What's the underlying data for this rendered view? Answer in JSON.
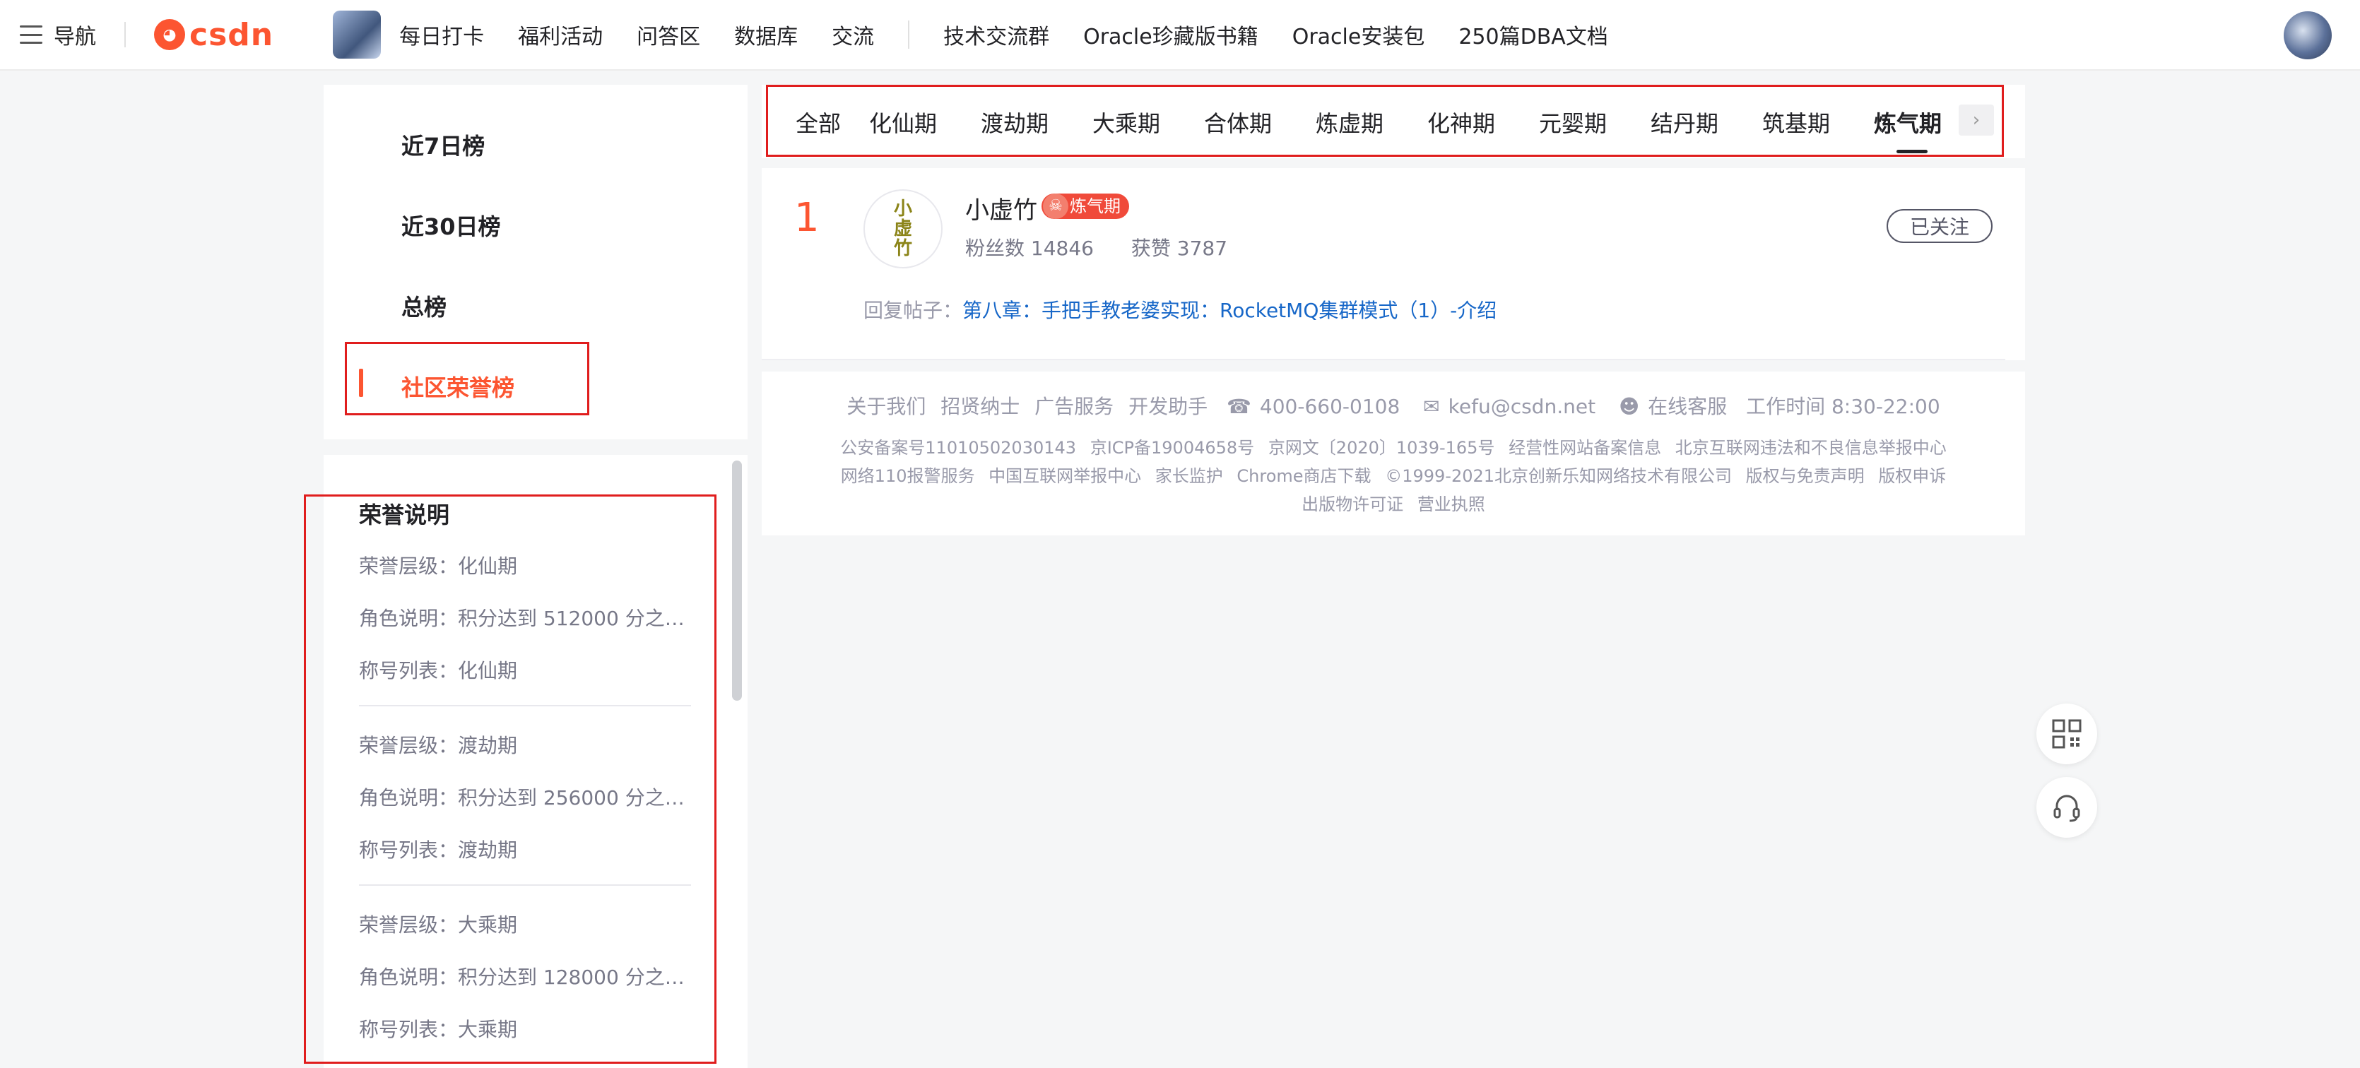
{
  "topbar": {
    "nav_label": "导航",
    "logo_text": "csdn",
    "links": [
      "每日打卡",
      "福利活动",
      "问答区",
      "数据库",
      "交流"
    ],
    "links2": [
      "技术交流群",
      "Oracle珍藏版书籍",
      "Oracle安装包",
      "250篇DBA文档"
    ]
  },
  "sidebar": {
    "items": [
      "近7日榜",
      "近30日榜",
      "总榜",
      "社区荣誉榜"
    ],
    "active_index": 3
  },
  "honor": {
    "title": "荣誉说明",
    "groups": [
      {
        "level": "荣誉层级：化仙期",
        "role": "角色说明：积分达到 512000 分之…",
        "titles": "称号列表：化仙期"
      },
      {
        "level": "荣誉层级：渡劫期",
        "role": "角色说明：积分达到 256000 分之…",
        "titles": "称号列表：渡劫期"
      },
      {
        "level": "荣誉层级：大乘期",
        "role": "角色说明：积分达到 128000 分之…",
        "titles": "称号列表：大乘期"
      }
    ]
  },
  "tabs": {
    "items": [
      "全部",
      "化仙期",
      "渡劫期",
      "大乘期",
      "合体期",
      "炼虚期",
      "化神期",
      "元婴期",
      "结丹期",
      "筑基期",
      "炼气期"
    ],
    "active_index": 10
  },
  "rank": {
    "number": "1",
    "avatar_text": "小虚竹",
    "name": "小虚竹",
    "badge": "炼气期",
    "fans": "粉丝数 14846",
    "likes": "获赞 3787",
    "follow_label": "已关注",
    "reply_label": "回复帖子：",
    "reply_link": "第八章：手把手教老婆实现：RocketMQ集群模式（1）-介绍"
  },
  "footer": {
    "line1": [
      "关于我们",
      "招贤纳士",
      "广告服务",
      "开发助手"
    ],
    "phone": "400-660-0108",
    "email": "kefu@csdn.net",
    "service": "在线客服",
    "hours": "工作时间 8:30-22:00",
    "line2": [
      "公安备案号11010502030143",
      "京ICP备19004658号",
      "京网文〔2020〕1039-165号",
      "经营性网站备案信息",
      "北京互联网违法和不良信息举报中心"
    ],
    "line3": [
      "网络110报警服务",
      "中国互联网举报中心",
      "家长监护",
      "Chrome商店下载",
      "©1999-2021北京创新乐知网络技术有限公司",
      "版权与免责声明",
      "版权申诉"
    ],
    "line4": [
      "出版物许可证",
      "营业执照"
    ]
  },
  "colors": {
    "accent": "#fc5531",
    "link": "#1767c8",
    "highlight_box": "#e01d1d"
  },
  "icons": {
    "qr": "qrcode-icon",
    "support": "headset-icon"
  }
}
